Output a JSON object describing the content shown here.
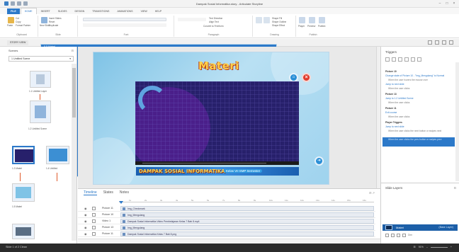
{
  "window": {
    "title": "Dampak Sosial Informatika.story - Articulate Storyline"
  },
  "ribbon": {
    "tabs": [
      "FILE",
      "HOME",
      "INSERT",
      "SLIDES",
      "DESIGN",
      "TRANSITIONS",
      "ANIMATIONS",
      "VIEW",
      "HELP"
    ],
    "active_tab": "HOME",
    "groups": [
      "Clipboard",
      "Slide",
      "Font",
      "Paragraph",
      "Drawing",
      "Publish"
    ],
    "clipboard": {
      "paste": "Paste",
      "cut": "Cut",
      "copy": "Copy",
      "format_painter": "Format Painter"
    },
    "slide": {
      "new_slide": "New Slide",
      "insert_slides": "Insert Slides",
      "reset": "Reset",
      "duplicate": "Duplicate"
    },
    "paragraph": {
      "text_direction": "Text Direction",
      "align_text": "Align Text",
      "convert": "Convert to Freeform"
    },
    "drawing": {
      "arrange": "Arrange",
      "quick_styles": "Quick Styles",
      "shape_fill": "Shape Fill",
      "shape_outline": "Shape Outline",
      "shape_effect": "Shape Effect"
    },
    "publish": {
      "player": "Player",
      "preview": "Preview",
      "publish": "Publish"
    }
  },
  "viewbar": {
    "story_view": "STORY VIEW",
    "slide_label": "5.5 Materi"
  },
  "scenes": {
    "header": "Scenes",
    "selected_scene": "1 Untitled Scene",
    "thumbs": [
      {
        "label": "1.1 Untitled Layer"
      },
      {
        "label": "1.2 Untitled Scene"
      },
      {
        "label": "1.3 Materi"
      },
      {
        "label": "1.4 Untitled"
      },
      {
        "label": "1.5 Materi"
      }
    ]
  },
  "slide": {
    "title": "Materi",
    "banner": "DAMPAK SOSIAL INFORMATIKA",
    "banner_sub": "Kelas VII SMP Semester"
  },
  "timeline": {
    "tabs": [
      "Timeline",
      "States",
      "Notes"
    ],
    "active_tab": "Timeline",
    "ticks": [
      "1s",
      "2s",
      "3s",
      "4s",
      "5s",
      "6s",
      "7s",
      "8s",
      "9s",
      "10s",
      "11s",
      "12s",
      "13s",
      "14s",
      "15s",
      "16s"
    ],
    "rows": [
      {
        "name": "Picture 11",
        "label": "Img_Checkmark"
      },
      {
        "name": "Picture 10",
        "label": "Img_Mengulang"
      },
      {
        "name": "Video 1",
        "label": "Dampak Sosial Informatika Video Pembelajaran Kelas 7 Bab 8.mp4"
      },
      {
        "name": "Picture 13",
        "label": "Img_Mengulang"
      },
      {
        "name": "Picture 11",
        "label": "Dampak Sosial Informatika Kelas 7 Bab 8.png"
      }
    ]
  },
  "triggers": {
    "header": "Triggers",
    "items": [
      {
        "type": "head",
        "text": "Picture 10"
      },
      {
        "type": "link",
        "text": "Change state of Picture 10 - \"Img_Mengulang\" to Normal"
      },
      {
        "type": "sub",
        "text": "When the user hovers the mouse over"
      },
      {
        "type": "link",
        "text": "Jump to next slide"
      },
      {
        "type": "sub",
        "text": "When the user clicks"
      },
      {
        "type": "head",
        "text": "Picture 13"
      },
      {
        "type": "link",
        "text": "Jump to 1.2 Untitled Scene"
      },
      {
        "type": "sub",
        "text": "When the user clicks"
      },
      {
        "type": "head",
        "text": "Picture 11"
      },
      {
        "type": "link",
        "text": "Exit course"
      },
      {
        "type": "sub",
        "text": "When the user clicks"
      },
      {
        "type": "head",
        "text": "Player Triggers"
      },
      {
        "type": "link",
        "text": "Jump to next slide"
      },
      {
        "type": "sub",
        "text": "When the user clicks the next button or swipes next"
      },
      {
        "type": "sel",
        "text": "Jump to previous slide"
      },
      {
        "type": "selsub",
        "text": "When the user clicks the prev button or swipes prev"
      }
    ]
  },
  "layers": {
    "header": "Slide Layers",
    "base_layer": "Materi",
    "base_right": "(Base Layer)",
    "dim_label": "Dim"
  },
  "status": {
    "left": "Slide 1 of 2    Clean",
    "zoom": "91%"
  },
  "colors": {
    "accent": "#2c79c9",
    "title_yellow": "#ffd24a",
    "video_bg": "#27206b",
    "close_red": "#e03b2c"
  }
}
